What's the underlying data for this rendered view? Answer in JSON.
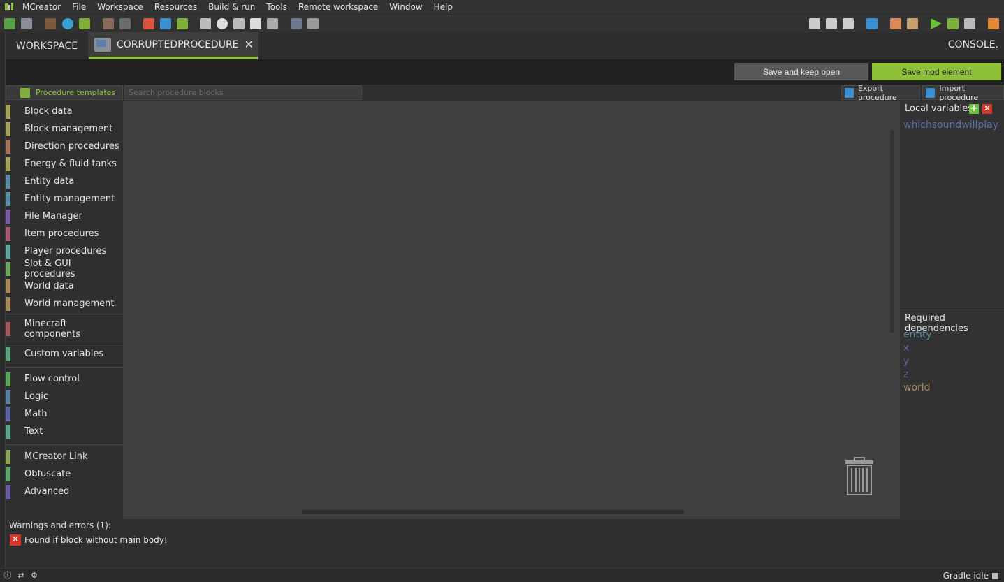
{
  "menu": {
    "items": [
      "MCreator",
      "File",
      "Workspace",
      "Resources",
      "Build & run",
      "Tools",
      "Remote workspace",
      "Window",
      "Help"
    ]
  },
  "tabs": {
    "workspace": "WORKSPACE",
    "procedure": "CORRUPTEDPROCEDURE",
    "console": "CONSOLE"
  },
  "actions": {
    "save_keep_open": "Save and keep open",
    "save_mod_element": "Save mod element"
  },
  "search": {
    "templates_label": "Procedure templates",
    "placeholder": "Search procedure blocks",
    "export_label": "Export procedure",
    "import_label": "Import procedure"
  },
  "categories": {
    "group1": [
      {
        "label": "Block data",
        "color": "#a5a55b"
      },
      {
        "label": "Block management",
        "color": "#a5a55b"
      },
      {
        "label": "Direction procedures",
        "color": "#a5745b"
      },
      {
        "label": "Energy & fluid tanks",
        "color": "#a5a55b"
      },
      {
        "label": "Entity data",
        "color": "#5b8fa5"
      },
      {
        "label": "Entity management",
        "color": "#5b8fa5"
      },
      {
        "label": "File Manager",
        "color": "#7a5ba5"
      },
      {
        "label": "Item procedures",
        "color": "#a55b6e"
      },
      {
        "label": "Player procedures",
        "color": "#5ba5a0"
      },
      {
        "label": "Slot & GUI procedures",
        "color": "#6aa55b"
      },
      {
        "label": "World data",
        "color": "#a5885b"
      },
      {
        "label": "World management",
        "color": "#a5885b"
      }
    ],
    "group2": [
      {
        "label": "Minecraft components",
        "color": "#a55b5b"
      }
    ],
    "group3": [
      {
        "label": "Custom variables",
        "color": "#5ba57a"
      }
    ],
    "group4": [
      {
        "label": "Flow control",
        "color": "#5ba55b"
      },
      {
        "label": "Logic",
        "color": "#5b80a5"
      },
      {
        "label": "Math",
        "color": "#5b67a5"
      },
      {
        "label": "Text",
        "color": "#5ba58c"
      }
    ],
    "group5": [
      {
        "label": "MCreator Link",
        "color": "#8fa55b"
      },
      {
        "label": "Obfuscate",
        "color": "#5ba568"
      },
      {
        "label": "Advanced",
        "color": "#6e5ba5"
      }
    ]
  },
  "local_variables": {
    "title": "Local variables",
    "items": [
      "whichsoundwillplay"
    ]
  },
  "dependencies": {
    "title": "Required dependencies",
    "items": [
      {
        "name": "entity",
        "color": "#5b8fa5"
      },
      {
        "name": "x",
        "color": "#5b67a5"
      },
      {
        "name": "y",
        "color": "#5b67a5"
      },
      {
        "name": "z",
        "color": "#5b67a5"
      },
      {
        "name": "world",
        "color": "#a5885b"
      }
    ]
  },
  "warnings": {
    "title": "Warnings and errors (1):",
    "items": [
      "Found if block without main body!"
    ]
  },
  "status": {
    "gradle": "Gradle idle"
  }
}
